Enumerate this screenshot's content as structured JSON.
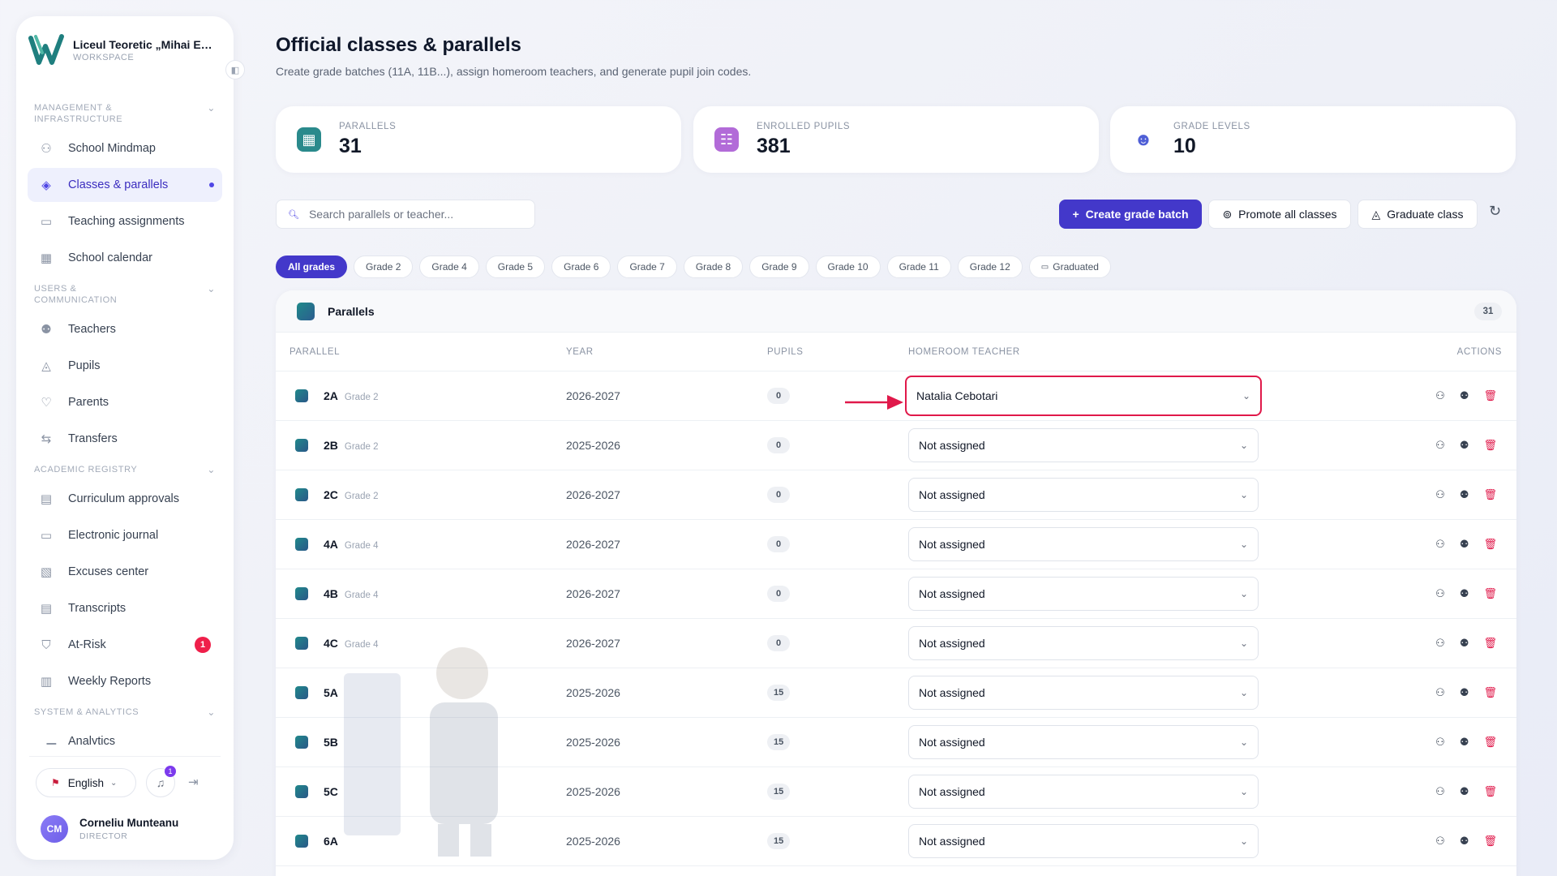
{
  "sidebar": {
    "school_name": "Liceul Teoretic „Mihai Emi...",
    "workspace_label": "WORKSPACE",
    "sections": [
      {
        "title": "MANAGEMENT & INFRASTRUCTURE",
        "items": [
          {
            "label": "School Mindmap",
            "icon": "mindmap-icon",
            "glyph": "⚇"
          },
          {
            "label": "Classes & parallels",
            "icon": "layers-icon",
            "glyph": "◈",
            "active": true
          },
          {
            "label": "Teaching assignments",
            "icon": "book-open-icon",
            "glyph": "▭"
          },
          {
            "label": "School calendar",
            "icon": "calendar-icon",
            "glyph": "▦"
          }
        ]
      },
      {
        "title": "USERS & COMMUNICATION",
        "items": [
          {
            "label": "Teachers",
            "icon": "users-icon",
            "glyph": "⚉"
          },
          {
            "label": "Pupils",
            "icon": "graduation-cap-icon",
            "glyph": "◬"
          },
          {
            "label": "Parents",
            "icon": "heart-icon",
            "glyph": "♡"
          },
          {
            "label": "Transfers",
            "icon": "arrows-swap-icon",
            "glyph": "⇆"
          }
        ]
      },
      {
        "title": "ACADEMIC REGISTRY",
        "items": [
          {
            "label": "Curriculum approvals",
            "icon": "file-check-icon",
            "glyph": "▤"
          },
          {
            "label": "Electronic journal",
            "icon": "journal-icon",
            "glyph": "▭"
          },
          {
            "label": "Excuses center",
            "icon": "file-edit-icon",
            "glyph": "▧"
          },
          {
            "label": "Transcripts",
            "icon": "file-text-icon",
            "glyph": "▤"
          },
          {
            "label": "At-Risk",
            "icon": "shield-icon",
            "glyph": "⛉",
            "badge": "1"
          },
          {
            "label": "Weekly Reports",
            "icon": "clipboard-icon",
            "glyph": "▥"
          }
        ]
      },
      {
        "title": "SYSTEM & ANALYTICS",
        "items": [
          {
            "label": "Analytics",
            "icon": "bar-chart-icon",
            "glyph": "▁▃"
          }
        ]
      }
    ],
    "language": "English",
    "notifications": "1",
    "user": {
      "initials": "CM",
      "name": "Corneliu Munteanu",
      "role": "DIRECTOR"
    }
  },
  "page": {
    "title": "Official classes & parallels",
    "subtitle": "Create grade batches (11A, 11B...), assign homeroom teachers, and generate pupil join codes."
  },
  "stats": [
    {
      "label": "PARALLELS",
      "value": "31",
      "icon": "classroom-icon",
      "color": "#2a8a8c"
    },
    {
      "label": "ENROLLED PUPILS",
      "value": "381",
      "icon": "pupils-icon",
      "color": "#b26bd8"
    },
    {
      "label": "GRADE LEVELS",
      "value": "10",
      "icon": "group-icon",
      "color": "#4f5fd6"
    }
  ],
  "toolbar": {
    "search_placeholder": "Search parallels or teacher...",
    "create_label": "Create grade batch",
    "promote_label": "Promote all classes",
    "graduate_label": "Graduate class"
  },
  "filters": [
    "All grades",
    "Grade 2",
    "Grade 4",
    "Grade 5",
    "Grade 6",
    "Grade 7",
    "Grade 8",
    "Grade 9",
    "Grade 10",
    "Grade 11",
    "Grade 12",
    "Graduated"
  ],
  "table": {
    "title": "Parallels",
    "count": "31",
    "headers": {
      "parallel": "PARALLEL",
      "year": "YEAR",
      "pupils": "PUPILS",
      "teacher": "HOMEROOM TEACHER",
      "actions": "ACTIONS"
    },
    "rows": [
      {
        "name": "2A",
        "grade": "Grade 2",
        "year": "2026-2027",
        "pupils": "0",
        "teacher": "Natalia Cebotari"
      },
      {
        "name": "2B",
        "grade": "Grade 2",
        "year": "2025-2026",
        "pupils": "0",
        "teacher": "Not assigned"
      },
      {
        "name": "2C",
        "grade": "Grade 2",
        "year": "2026-2027",
        "pupils": "0",
        "teacher": "Not assigned"
      },
      {
        "name": "4A",
        "grade": "Grade 4",
        "year": "2026-2027",
        "pupils": "0",
        "teacher": "Not assigned"
      },
      {
        "name": "4B",
        "grade": "Grade 4",
        "year": "2026-2027",
        "pupils": "0",
        "teacher": "Not assigned"
      },
      {
        "name": "4C",
        "grade": "Grade 4",
        "year": "2026-2027",
        "pupils": "0",
        "teacher": "Not assigned"
      },
      {
        "name": "5A",
        "grade": "",
        "year": "2025-2026",
        "pupils": "15",
        "teacher": "Not assigned"
      },
      {
        "name": "5B",
        "grade": "",
        "year": "2025-2026",
        "pupils": "15",
        "teacher": "Not assigned"
      },
      {
        "name": "5C",
        "grade": "",
        "year": "2025-2026",
        "pupils": "15",
        "teacher": "Not assigned"
      },
      {
        "name": "6A",
        "grade": "",
        "year": "2025-2026",
        "pupils": "15",
        "teacher": "Not assigned"
      }
    ]
  },
  "colors": {
    "accent": "#4338ca",
    "highlight": "#e0194a"
  }
}
